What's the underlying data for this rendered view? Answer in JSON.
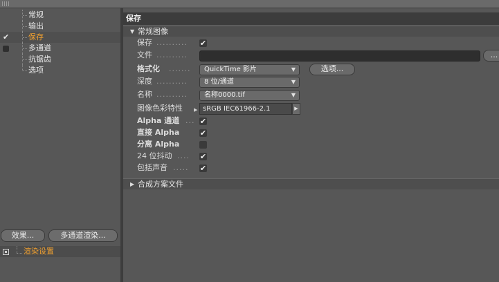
{
  "tree": {
    "items": [
      {
        "label": "常规",
        "check": ""
      },
      {
        "label": "输出",
        "check": ""
      },
      {
        "label": "保存",
        "check": "✔"
      },
      {
        "label": "多通道",
        "check": ""
      },
      {
        "label": "抗锯齿",
        "check": ""
      },
      {
        "label": "选项",
        "check": ""
      }
    ]
  },
  "left_buttons": {
    "effects": "效果...",
    "multipass": "多通道渲染..."
  },
  "render_settings": {
    "label": "渲染设置"
  },
  "panel": {
    "title": "保存",
    "section_regular": "常规图像",
    "section_compositing": "合成方案文件"
  },
  "fields": {
    "save": {
      "label": "保存",
      "checked": "✔"
    },
    "file": {
      "label": "文件",
      "value": "",
      "browse": "..."
    },
    "format": {
      "label": "格式化",
      "value": "QuickTime 影片",
      "options_button": "选项..."
    },
    "depth": {
      "label": "深度",
      "value": "8 位/通道"
    },
    "name": {
      "label": "名称",
      "value": "名称0000.tif"
    },
    "color_profile": {
      "label": "图像色彩特性",
      "value": "sRGB IEC61966-2.1"
    },
    "alpha_channel": {
      "label": "Alpha 通道",
      "checked": "✔"
    },
    "straight_alpha": {
      "label": "直接 Alpha",
      "checked": "✔"
    },
    "separate_alpha": {
      "label": "分离 Alpha",
      "checked": ""
    },
    "dithering": {
      "label": "24 位抖动",
      "checked": "✔"
    },
    "include_sound": {
      "label": "包括声音",
      "checked": "✔"
    }
  },
  "colors": {
    "accent": "#f0a030",
    "background": "#575757",
    "title_bar": "#3c3c3c"
  }
}
